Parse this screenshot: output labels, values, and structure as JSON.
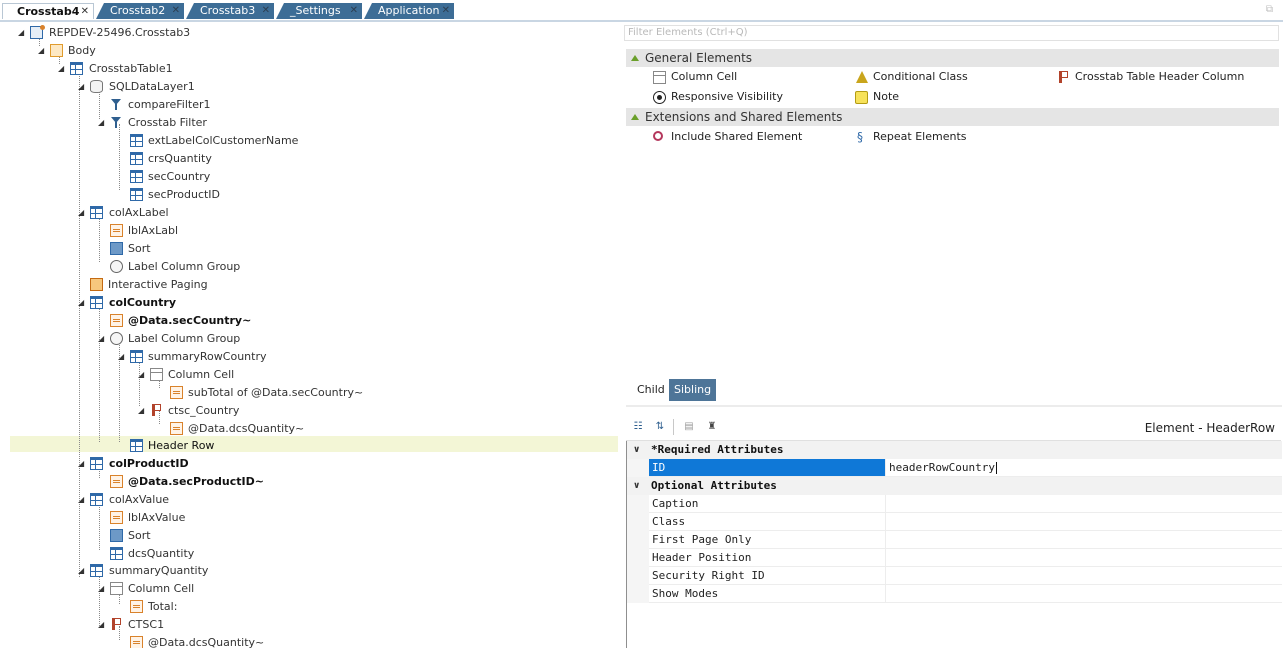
{
  "tabs": [
    {
      "label": "Crosstab4",
      "active": true
    },
    {
      "label": "Crosstab2",
      "active": false
    },
    {
      "label": "Crosstab3",
      "active": false
    },
    {
      "label": "_Settings",
      "active": false
    },
    {
      "label": "Application",
      "active": false
    }
  ],
  "tree": {
    "root": "REPDEV-25496.Crosstab3",
    "body": "Body",
    "crosstab_table": "CrosstabTable1",
    "sql_datalayer": "SQLDataLayer1",
    "compare_filter": "compareFilter1",
    "crosstab_filter": "Crosstab Filter",
    "ext_label": "extLabelColCustomerName",
    "crs_quantity": "crsQuantity",
    "sec_country": "secCountry",
    "sec_product": "secProductID",
    "col_ax_label": "colAxLabel",
    "lbl_ax_labl": "lblAxLabl",
    "sort1": "Sort",
    "label_col_group1": "Label Column Group",
    "interactive_paging": "Interactive Paging",
    "col_country": "colCountry",
    "data_sec_country": "@Data.secCountry~",
    "label_col_group2": "Label Column Group",
    "summary_row_country": "summaryRowCountry",
    "column_cell1": "Column Cell",
    "subtotal": "subTotal of @Data.secCountry~",
    "ctsc_country": "ctsc_Country",
    "data_dcs_qty1": "@Data.dcsQuantity~",
    "header_row": "Header Row",
    "col_product_id": "colProductID",
    "data_sec_product": "@Data.secProductID~",
    "col_ax_value": "colAxValue",
    "lbl_ax_value": "lblAxValue",
    "sort2": "Sort",
    "dcs_quantity": "dcsQuantity",
    "summary_quantity": "summaryQuantity",
    "column_cell2": "Column Cell",
    "total": "Total:",
    "ctsc1": "CTSC1",
    "data_dcs_qty2": "@Data.dcsQuantity~"
  },
  "filter": {
    "placeholder": "Filter Elements (Ctrl+Q)"
  },
  "toolbox": {
    "general_title": "General Elements",
    "general_items": [
      "Column Cell",
      "Conditional Class",
      "Crosstab Table Header Column",
      "Responsive Visibility",
      "Note"
    ],
    "ext_title": "Extensions and Shared Elements",
    "ext_items": [
      "Include Shared Element",
      "Repeat Elements"
    ]
  },
  "child_sibling": {
    "child": "Child",
    "sibling": "Sibling"
  },
  "props": {
    "element_title": "Element - HeaderRow",
    "required_title": "*Required Attributes",
    "optional_title": "Optional Attributes",
    "required": [
      {
        "name": "ID",
        "value": "headerRowCountry"
      }
    ],
    "optional": [
      {
        "name": "Caption",
        "value": ""
      },
      {
        "name": "Class",
        "value": ""
      },
      {
        "name": "First Page Only",
        "value": ""
      },
      {
        "name": "Header Position",
        "value": ""
      },
      {
        "name": "Security Right ID",
        "value": ""
      },
      {
        "name": "Show Modes",
        "value": ""
      }
    ]
  }
}
